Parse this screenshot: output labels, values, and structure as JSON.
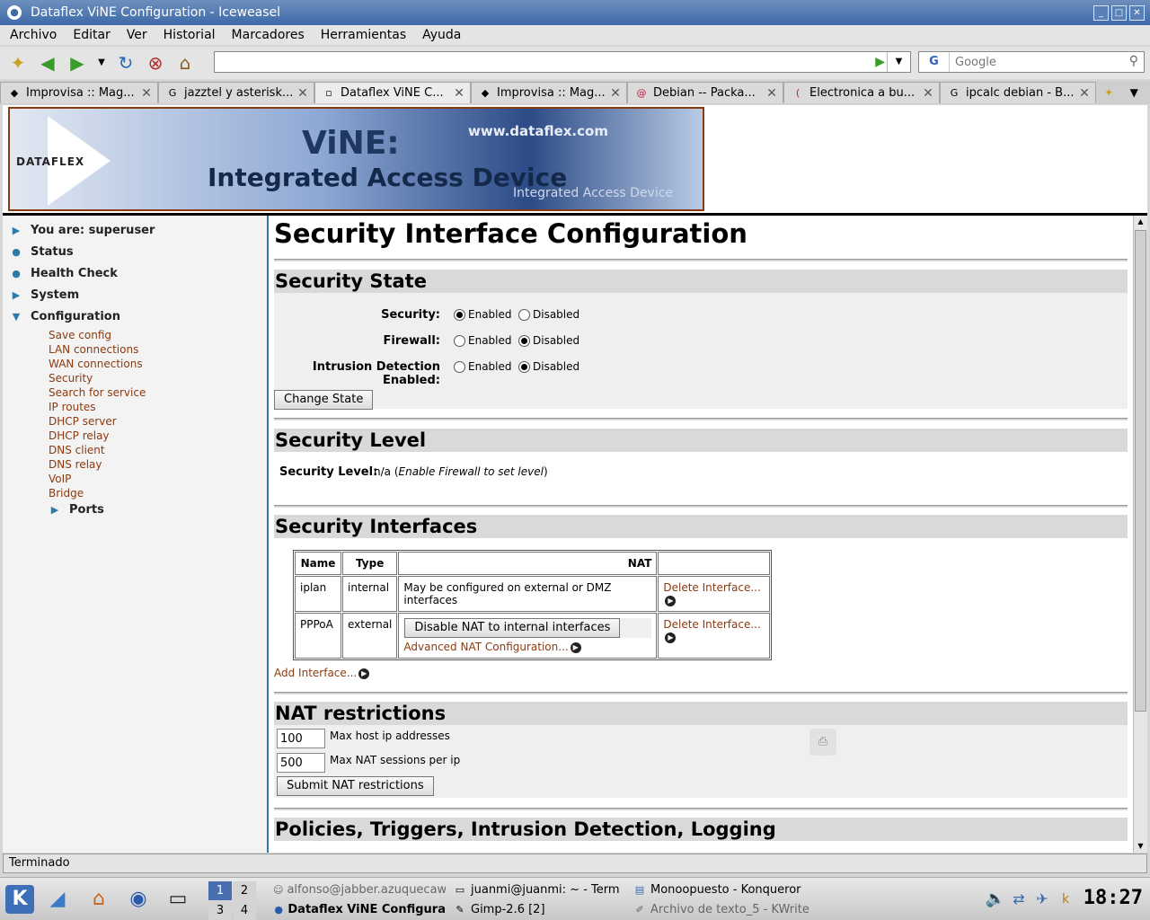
{
  "window": {
    "title": "Dataflex ViNE Configuration - Iceweasel"
  },
  "menu": [
    "Archivo",
    "Editar",
    "Ver",
    "Historial",
    "Marcadores",
    "Herramientas",
    "Ayuda"
  ],
  "navbar": {
    "url": "",
    "search_placeholder": "Google",
    "search_engine": "G"
  },
  "tabs": [
    {
      "label": "Improvisa :: Mag...",
      "active": false
    },
    {
      "label": "jazztel y asterisk...",
      "active": false
    },
    {
      "label": "Dataflex ViNE C...",
      "active": true
    },
    {
      "label": "Improvisa :: Mag...",
      "active": false
    },
    {
      "label": "Debian -- Packa...",
      "active": false
    },
    {
      "label": "Electronica a bu...",
      "active": false
    },
    {
      "label": "ipcalc debian - B...",
      "active": false
    }
  ],
  "banner": {
    "logo": "DATAFLEX",
    "url": "www.dataflex.com",
    "product": "ViNE:",
    "tagline": "Integrated Access Device",
    "tagline_faded": "Integrated Access Device"
  },
  "sidebar": {
    "top": [
      {
        "label": "You are: superuser",
        "marker": "arrow"
      },
      {
        "label": "Status",
        "marker": "dot"
      },
      {
        "label": "Health Check",
        "marker": "dot"
      },
      {
        "label": "System",
        "marker": "arrow"
      },
      {
        "label": "Configuration",
        "marker": "down"
      }
    ],
    "sub": [
      "Save config",
      "LAN connections",
      "WAN connections",
      "Security",
      "Search for service",
      "IP routes",
      "DHCP server",
      "DHCP relay",
      "DNS client",
      "DNS relay",
      "VoIP",
      "Bridge"
    ],
    "current": "Ports"
  },
  "content": {
    "title": "Security Interface Configuration",
    "state": {
      "heading": "Security State",
      "rows": [
        {
          "label": "Security:",
          "selected": "Enabled"
        },
        {
          "label": "Firewall:",
          "selected": "Disabled"
        },
        {
          "label": "Intrusion Detection Enabled:",
          "selected": "Disabled"
        }
      ],
      "opt_enabled": "Enabled",
      "opt_disabled": "Disabled",
      "button": "Change State"
    },
    "level": {
      "heading": "Security Level",
      "label": "Security Level:",
      "value": "n/a (",
      "note": "Enable Firewall to set level",
      "close": ")"
    },
    "interfaces": {
      "heading": "Security Interfaces",
      "columns": [
        "Name",
        "Type",
        "NAT",
        ""
      ],
      "rows": [
        {
          "name": "iplan",
          "type": "internal",
          "nat_text": "May be configured on external or DMZ interfaces",
          "action": "Delete Interface..."
        },
        {
          "name": "PPPoA",
          "type": "external",
          "nat_button": "Disable NAT to internal interfaces",
          "nat_link": "Advanced NAT Configuration...",
          "action": "Delete Interface..."
        }
      ],
      "add": "Add Interface..."
    },
    "nat": {
      "heading": "NAT restrictions",
      "max_hosts_value": "100",
      "max_hosts_label": "Max host ip addresses",
      "max_sessions_value": "500",
      "max_sessions_label": "Max NAT sessions per ip",
      "button": "Submit NAT restrictions"
    },
    "policies_heading": "Policies, Triggers, Intrusion Detection, Logging"
  },
  "status": "Terminado",
  "taskbar": {
    "pager": [
      "1",
      "2",
      "3",
      "4"
    ],
    "tasks": [
      "alfonso@jabber.azuquecaw",
      "juanmi@juanmi: ~ - Term",
      "Monoopuesto - Konqueror",
      "Dataflex ViNE Configura",
      "Gimp-2.6 [2]",
      "Archivo de texto_5 - KWrite"
    ],
    "clock": "18:27"
  },
  "colors": {
    "link": "#8b3a10",
    "accent": "#2e7aa8",
    "titlebar": "#3e6aa8"
  }
}
